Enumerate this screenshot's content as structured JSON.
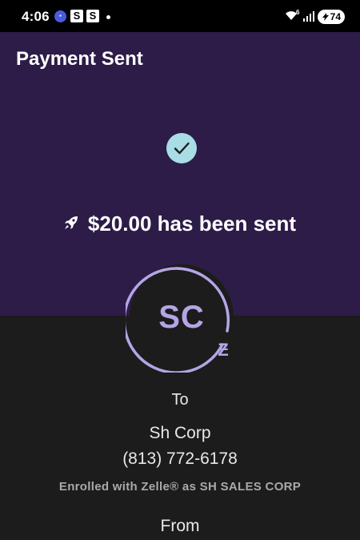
{
  "status_bar": {
    "time": "4:06",
    "notif_icon_1": "S",
    "notif_icon_2": "S",
    "wifi_badge": "6",
    "battery": "74"
  },
  "header": {
    "title": "Payment Sent"
  },
  "confirmation": {
    "message": "$20.00 has been sent"
  },
  "recipient": {
    "initials": "SC",
    "to_label": "To",
    "name": "Sh Corp",
    "phone": "(813) 772-6178",
    "enrolled_note": "Enrolled with Zelle® as SH SALES CORP",
    "badge": "Ƶ"
  },
  "from": {
    "label": "From"
  },
  "colors": {
    "header_bg": "#2c1c47",
    "body_bg": "#1c1c1c",
    "accent": "#b5a5e6",
    "check_bg": "#a8dde6"
  },
  "icons": [
    "check-icon",
    "rocket-icon",
    "zelle-icon",
    "wifi-icon",
    "signal-icon",
    "battery-icon"
  ]
}
